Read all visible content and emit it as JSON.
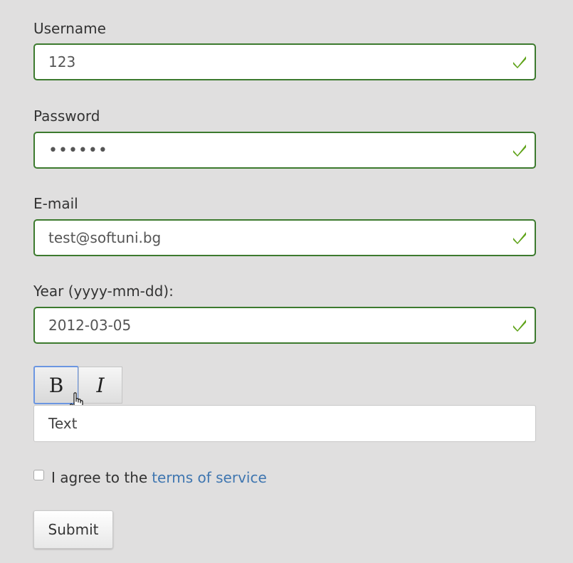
{
  "form": {
    "fields": [
      {
        "label": "Username",
        "value": "123"
      },
      {
        "label": "Password",
        "value": "••••••"
      },
      {
        "label": "E-mail",
        "value": "test@softuni.bg"
      },
      {
        "label": "Year (yyyy-mm-dd):",
        "value": "2012-03-05"
      }
    ],
    "toolbar": {
      "bold_label": "B",
      "italic_label": "I"
    },
    "editor_text": "Text",
    "agree": {
      "prefix": "I agree to the",
      "link": "terms of service",
      "checked": false
    },
    "submit_label": "Submit"
  },
  "colors": {
    "background": "#e0dfdf",
    "valid_border": "#3c7a2e",
    "check_green": "#5fa319",
    "link": "#3f76b0",
    "focus_blue": "#6b96e2"
  },
  "icons": {
    "valid": "check-icon",
    "cursor": "hand-pointer-icon"
  }
}
